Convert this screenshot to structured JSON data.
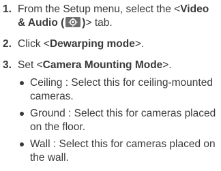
{
  "steps": [
    {
      "number": "1.",
      "pre": "From the Setup menu, select the <",
      "tab_name": "Video & Audio (",
      "tab_close": ")",
      "post": "> tab.",
      "icon": "video-audio-tab-icon"
    },
    {
      "number": "2.",
      "pre": "Click <",
      "bold": "Dewarping mode",
      "post": ">."
    },
    {
      "number": "3.",
      "pre": "Set <",
      "bold": "Camera Mounting Mode",
      "post": ">."
    }
  ],
  "mounting_options": [
    "Ceiling : Select this for ceiling-mounted cameras.",
    "Ground : Select this for cameras placed on the floor.",
    "Wall : Select this for cameras placed on the wall."
  ]
}
